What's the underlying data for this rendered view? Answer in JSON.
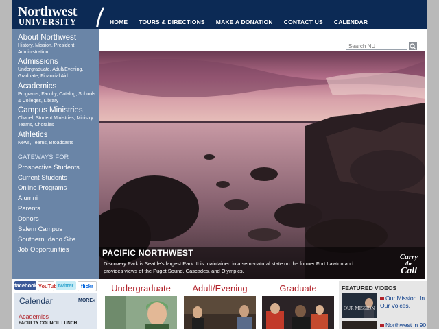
{
  "header": {
    "logo_top": "Northwest",
    "logo_bottom": "UNIVERSITY",
    "nav": [
      "HOME",
      "TOURS & DIRECTIONS",
      "MAKE A DONATION",
      "CONTACT US",
      "CALENDAR"
    ]
  },
  "sidebar": {
    "sections": [
      {
        "title": "About Northwest",
        "desc": "History, Mission, President, Administration"
      },
      {
        "title": "Admissions",
        "desc": "Undergraduate, Adult/Evening, Graduate, Financial Aid"
      },
      {
        "title": "Academics",
        "desc": "Programs, Faculty, Catalog, Schools & Colleges, Library"
      },
      {
        "title": "Campus Ministries",
        "desc": "Chapel, Student Ministries, Ministry Teams, Chorales"
      },
      {
        "title": "Athletics",
        "desc": "News, Teams, Broadcasts"
      }
    ],
    "gateways_label": "GATEWAYS FOR",
    "gateways": [
      "Prospective Students",
      "Current Students",
      "Online Programs",
      "Alumni",
      "Parents",
      "Donors",
      "Salem Campus",
      "Southern Idaho Site",
      "Job Opportunities"
    ]
  },
  "search": {
    "placeholder": "Search NU"
  },
  "hero": {
    "title": "PACIFIC NORTHWEST",
    "text": "Discovery Park is Seattle's largest Park. It is maintained in a semi-natural state on the former Fort Lawton and provides views of the Puget Sound, Cascades, and Olympics.",
    "badge_line1": "Carry",
    "badge_line2": "the",
    "badge_line3": "Call"
  },
  "social": [
    "facebook",
    "YouTube",
    "twitter",
    "flickr"
  ],
  "calendar": {
    "title": "Calendar",
    "more": "MORE»",
    "category": "Academics",
    "item": "FACULTY COUNCIL LUNCH"
  },
  "programs": [
    "Undergraduate",
    "Adult/Evening",
    "Graduate"
  ],
  "featured": {
    "title": "FEATURED VIDEOS",
    "thumb_text": "OUR MISSION",
    "link1": "Our Mission. In Our Voices.",
    "link2": "Northwest in 90"
  },
  "colors": {
    "header_bg": "#0c2a55",
    "sidebar_bg": "#6a85a7",
    "accent_red": "#b1222a",
    "calendar_bg": "#dfe6ef"
  }
}
